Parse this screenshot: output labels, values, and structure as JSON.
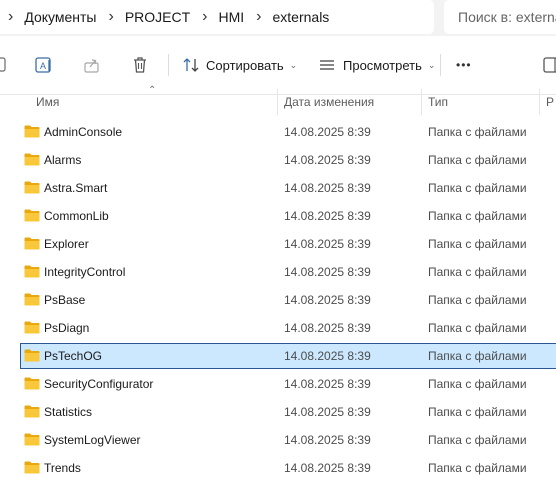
{
  "address_bar": {
    "breadcrumbs": [
      "Документы",
      "PROJECT",
      "HMI",
      "externals"
    ],
    "search_placeholder": "Поиск в: externals"
  },
  "toolbar": {
    "sort_label": "Сортировать",
    "view_label": "Просмотреть",
    "more_label": "•••",
    "icons": [
      "copy-icon",
      "rename-icon",
      "share-icon",
      "delete-icon",
      "sort-icon",
      "view-icon",
      "details-pane-icon"
    ]
  },
  "columns": {
    "name": "Имя",
    "date": "Дата изменения",
    "type": "Тип",
    "size": "Р"
  },
  "files": [
    {
      "name": "AdminConsole",
      "date": "14.08.2025 8:39",
      "type": "Папка с файлами"
    },
    {
      "name": "Alarms",
      "date": "14.08.2025 8:39",
      "type": "Папка с файлами"
    },
    {
      "name": "Astra.Smart",
      "date": "14.08.2025 8:39",
      "type": "Папка с файлами"
    },
    {
      "name": "CommonLib",
      "date": "14.08.2025 8:39",
      "type": "Папка с файлами"
    },
    {
      "name": "Explorer",
      "date": "14.08.2025 8:39",
      "type": "Папка с файлами"
    },
    {
      "name": "IntegrityControl",
      "date": "14.08.2025 8:39",
      "type": "Папка с файлами"
    },
    {
      "name": "PsBase",
      "date": "14.08.2025 8:39",
      "type": "Папка с файлами"
    },
    {
      "name": "PsDiagn",
      "date": "14.08.2025 8:39",
      "type": "Папка с файлами"
    },
    {
      "name": "PsTechOG",
      "date": "14.08.2025 8:39",
      "type": "Папка с файлами",
      "selected": true
    },
    {
      "name": "SecurityConfigurator",
      "date": "14.08.2025 8:39",
      "type": "Папка с файлами"
    },
    {
      "name": "Statistics",
      "date": "14.08.2025 8:39",
      "type": "Папка с файлами"
    },
    {
      "name": "SystemLogViewer",
      "date": "14.08.2025 8:39",
      "type": "Папка с файлами"
    },
    {
      "name": "Trends",
      "date": "14.08.2025 8:39",
      "type": "Папка с файлами"
    }
  ],
  "colors": {
    "selection_bg": "#cce8ff",
    "selection_border": "#2b5797",
    "folder": "#f8c73a"
  }
}
